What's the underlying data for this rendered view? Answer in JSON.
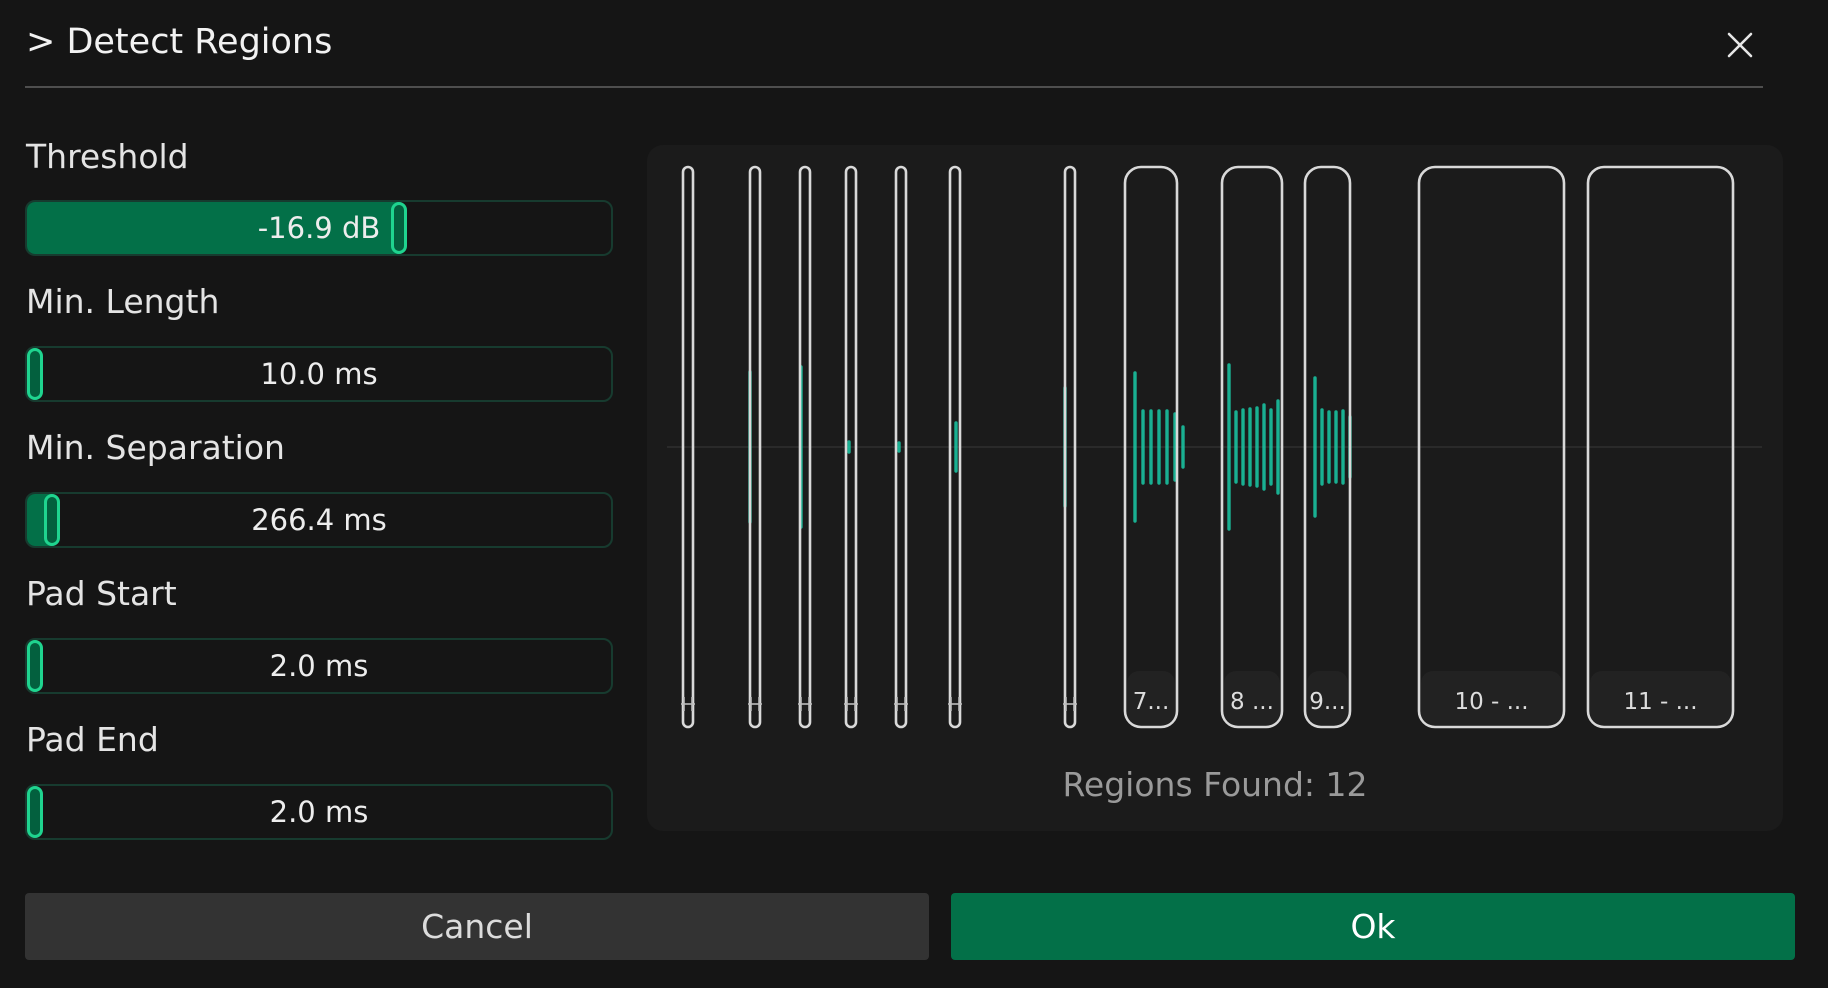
{
  "dialog": {
    "title": "> Detect Regions"
  },
  "controls": [
    {
      "label": "Threshold",
      "value_text": "-16.9 dB",
      "fraction": 0.64
    },
    {
      "label": "Min. Length",
      "value_text": "10.0 ms",
      "fraction": 0.0
    },
    {
      "label": "Min. Separation",
      "value_text": "266.4 ms",
      "fraction": 0.03
    },
    {
      "label": "Pad Start",
      "value_text": "2.0 ms",
      "fraction": 0.0
    },
    {
      "label": "Pad End",
      "value_text": "2.0 ms",
      "fraction": 0.0
    }
  ],
  "regions": {
    "found_text": "Regions Found: 12",
    "labels": [
      "",
      "",
      "",
      "",
      "",
      "",
      "",
      "7...",
      "8 ...",
      "9...",
      "10 - ...",
      "11 - ..."
    ]
  },
  "buttons": {
    "cancel": "Cancel",
    "ok": "Ok"
  },
  "colors": {
    "accent": "#037048",
    "waveform": "#19d6b0",
    "handle": "#1fd48f"
  },
  "icons": {
    "close": "close-icon"
  }
}
